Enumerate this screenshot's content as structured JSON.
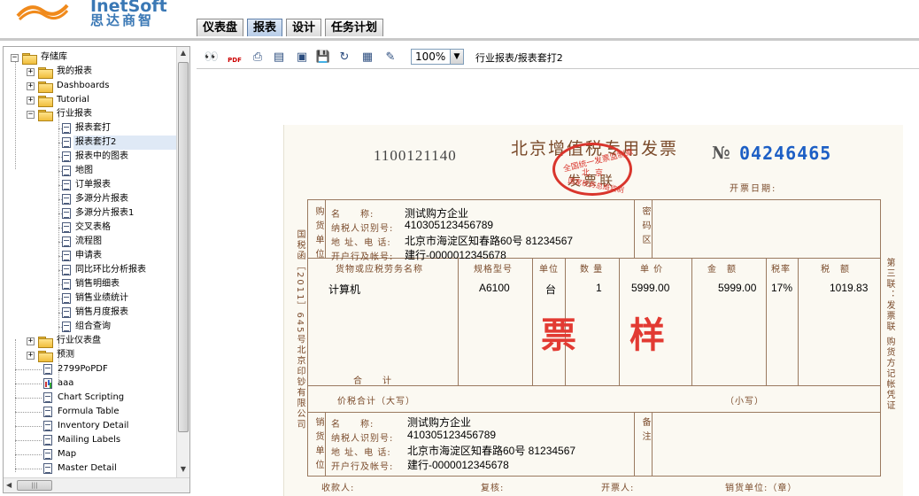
{
  "header": {
    "logo_text": "InetSoft",
    "logo_cn": "思达商智",
    "tabs": [
      {
        "label": "仪表盘",
        "active": false
      },
      {
        "label": "报表",
        "active": true
      },
      {
        "label": "设计",
        "active": false
      },
      {
        "label": "任务计划",
        "active": false
      }
    ]
  },
  "tree": {
    "root": "存储库",
    "folders": {
      "my_reports": "我的报表",
      "dashboards": "Dashboards",
      "tutorial": "Tutorial",
      "industry_reports": "行业报表",
      "industry_dashboard": "行业仪表盘",
      "forecast": "预测"
    },
    "industry_items": [
      "报表套打",
      "报表套打2",
      "报表中的图表",
      "地图",
      "订单报表",
      "多源分片报表",
      "多源分片报表1",
      "交叉表格",
      "流程图",
      "申请表",
      "同比环比分析报表",
      "销售明细表",
      "销售业绩统计",
      "销售月度报表",
      "组合查询"
    ],
    "selected": "报表套打2",
    "root_items": [
      "2799PoPDF",
      "aaa",
      "Chart Scripting",
      "Formula Table",
      "Inventory Detail",
      "Mailing Labels",
      "Map",
      "Master Detail"
    ],
    "icons": [
      "folder-icon",
      "report-icon",
      "chart-report-icon"
    ]
  },
  "toolbar": {
    "icons": [
      "binoculars-icon",
      "pdf-icon",
      "print-icon",
      "printer-icon",
      "preview-icon",
      "save-icon",
      "refresh-icon",
      "export-icon",
      "edit-icon"
    ],
    "pdf_label": "PDF",
    "zoom": "100%",
    "breadcrumb": "行业报表/报表套打2"
  },
  "invoice": {
    "code": "1100121140",
    "title": "北京增值税专用发票",
    "subtitle": "发票联",
    "no_symbol": "№",
    "number": "04246465",
    "date_label": "开票日期:",
    "seal_top": "全国统一发票监制章",
    "seal_mid": "北京",
    "seal_bottom": "国家税务总局监制",
    "buyer_side": "购货单位",
    "seller_side": "销货单位",
    "code_area": "密码区",
    "remarks": "备注",
    "field_labels": {
      "name": "名　　称:",
      "tax_id": "纳税人识别号:",
      "address": "地 址、电 话:",
      "bank": "开户行及帐号:"
    },
    "buyer": {
      "name": "测试购方企业",
      "tax_id": "410305123456789",
      "address": "北京市海淀区知春路60号 81234567",
      "bank": "建行-0000012345678"
    },
    "seller": {
      "name": "测试购方企业",
      "tax_id": "410305123456789",
      "address": "北京市海淀区知春路60号 81234567",
      "bank": "建行-0000012345678"
    },
    "columns": [
      "货物或应税劳务名称",
      "规格型号",
      "单位",
      "数 量",
      "单 价",
      "金　额",
      "税率",
      "税　额"
    ],
    "items": [
      {
        "name": "计算机",
        "spec": "A6100",
        "unit": "台",
        "qty": "1",
        "price": "5999.00",
        "amount": "5999.00",
        "rate": "17%",
        "tax": "1019.83"
      }
    ],
    "total_label": "合　　计",
    "total_words_label": "价税合计（大写）",
    "total_small_label": "（小写）",
    "stamp_chars": [
      "票",
      "样"
    ],
    "left_side_text": "国税函［2011］645号北京印钞有限公司",
    "right_side_text": "第三联：发票联 购货方记帐凭证",
    "footer": {
      "payee": "收款人:",
      "reviewer": "复核:",
      "issuer": "开票人:",
      "seller_seal": "销货单位:（章）"
    }
  }
}
